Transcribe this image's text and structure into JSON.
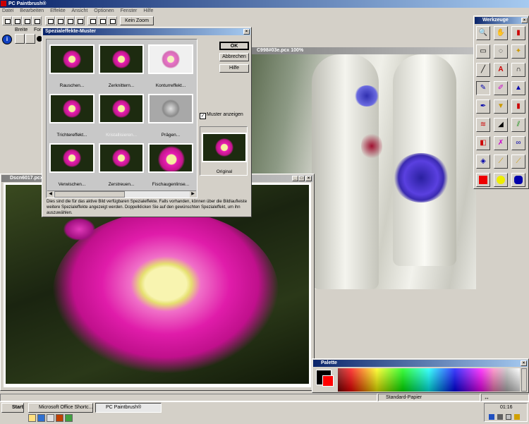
{
  "app": {
    "title": "PC Paintbrush®",
    "menu": [
      "Datei",
      "Bearbeiten",
      "Effekte",
      "Ansicht",
      "Optionen",
      "Fenster",
      "Hilfe"
    ],
    "zoom_button": "Kein Zoom",
    "ruler": {
      "breite_label": "Breite",
      "form_label": "Form"
    }
  },
  "dialog": {
    "title": "Spezialeffekte-Muster",
    "ok": "OK",
    "cancel": "Abbrechen",
    "help": "Hilfe",
    "checkbox_label": "Muster anzeigen",
    "checkbox_checked": true,
    "original_label": "Original",
    "effects": [
      "Rauschen...",
      "Zerknittern...",
      "Konturreffekt...",
      "Trichtereffekt...",
      "Kristallisieren...",
      "Prägen...",
      "Verwischen...",
      "Zerstreuen...",
      "Fischaugenlinse..."
    ],
    "description": "Dies sind die für das aktive Bild verfügbaren Spezialeffekte. Falls vorhanden, können über die Bildlaufleiste weitere Spezialeffekte angezeigt werden. Doppelklicken Sie auf den gewünschten Spezialeffekt, um ihn auszuwählen."
  },
  "windows": {
    "photo1_title": "C998#03e.pcx  100%",
    "photo2_title": "Dscn6017.pcx"
  },
  "tools_panel": {
    "title": "Werkzeuge"
  },
  "palette": {
    "title": "Palette",
    "fg_color": "#000000",
    "bg_color": "#ff0000"
  },
  "status": {
    "paper": "Standard-Papier",
    "arrow": "↔"
  },
  "taskbar": {
    "start": "Start",
    "tasks": [
      "Microsoft Office Shortc...",
      "PC Paintbrush®"
    ],
    "clock": "01:16"
  }
}
